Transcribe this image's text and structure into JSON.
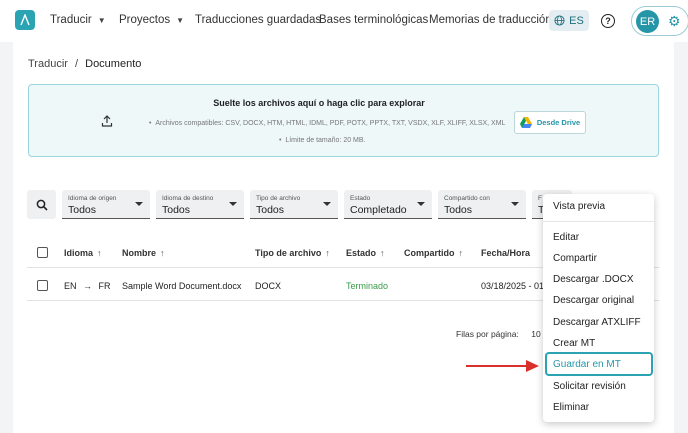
{
  "nav": {
    "items": [
      {
        "label": "Traducir",
        "has_chevron": true
      },
      {
        "label": "Proyectos",
        "has_chevron": true
      },
      {
        "label": "Traducciones guardadas",
        "has_chevron": false
      },
      {
        "label": "Bases terminológicas",
        "has_chevron": false
      },
      {
        "label": "Memorias de traducción",
        "has_chevron": false
      }
    ],
    "language": "ES",
    "help": "?",
    "user_initials": "ER"
  },
  "breadcrumb": {
    "parent": "Traducir",
    "separator": "/",
    "current": "Documento"
  },
  "dropzone": {
    "title": "Suelte los archivos aquí o haga clic para explorar",
    "compatible": "Archivos compatibles: CSV, DOCX, HTM, HTML, IDML, PDF, POTX, PPTX, TXT, VSDX, XLF, XLIFF, XLSX, XML",
    "size_limit": "Límite de tamaño: 20 MB.",
    "drive_button": "Desde Drive"
  },
  "filters": [
    {
      "label": "Idioma de origen",
      "value": "Todos"
    },
    {
      "label": "Idioma de destino",
      "value": "Todos"
    },
    {
      "label": "Tipo de archivo",
      "value": "Todos"
    },
    {
      "label": "Estado",
      "value": "Completado"
    },
    {
      "label": "Compartido con",
      "value": "Todos"
    },
    {
      "label": "F",
      "value": "T"
    }
  ],
  "table": {
    "headers": [
      "Idioma",
      "Nombre",
      "Tipo de archivo",
      "Estado",
      "Compartido",
      "Fecha/Hora"
    ],
    "sort_arrow": "↑",
    "rows": [
      {
        "source": "EN",
        "arrow": "→",
        "target": "FR",
        "name": "Sample Word Document.docx",
        "type": "DOCX",
        "status": "Terminado",
        "shared": "",
        "datetime": "03/18/2025 - 01:"
      }
    ]
  },
  "pager": {
    "label": "Filas por página:",
    "value": "10"
  },
  "menu": {
    "items": [
      "Vista previa",
      "Editar",
      "Compartir",
      "Descargar .DOCX",
      "Descargar original",
      "Descargar ATXLIFF",
      "Crear MT",
      "Guardar en MT",
      "Solicitar revisión",
      "Eliminar"
    ],
    "highlighted": "Guardar en MT"
  },
  "colors": {
    "accent": "#2aa3b3",
    "status_done": "#3a9a4a",
    "arrow": "#d9302c"
  }
}
